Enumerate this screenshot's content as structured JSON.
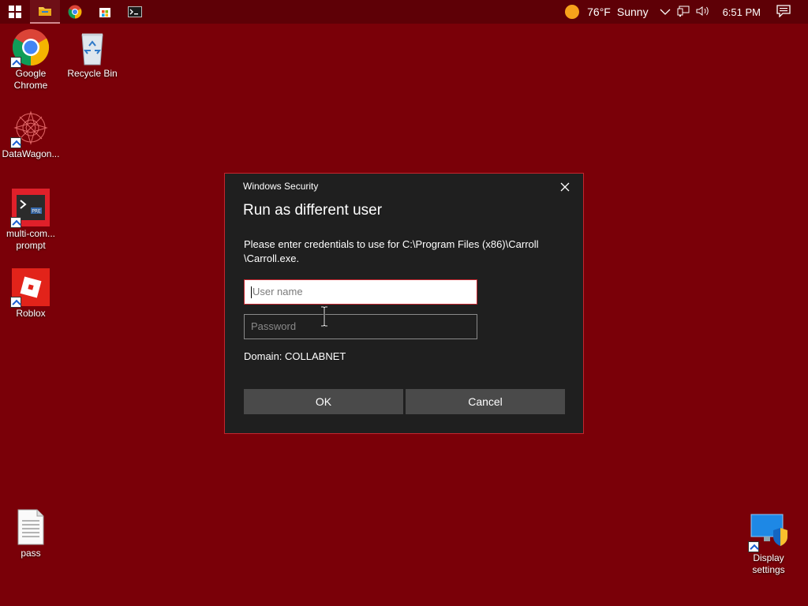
{
  "taskbar": {
    "pinned": [
      {
        "name": "start",
        "icon": "windows-logo-icon"
      },
      {
        "name": "file-explorer",
        "icon": "folder-icon"
      },
      {
        "name": "chrome",
        "icon": "chrome-icon"
      },
      {
        "name": "store",
        "icon": "store-icon"
      },
      {
        "name": "terminal",
        "icon": "terminal-icon"
      }
    ],
    "weather": {
      "temperature": "76°F",
      "condition": "Sunny"
    },
    "clock": "6:51 PM"
  },
  "desktop": {
    "icons": [
      {
        "label_line1": "Google",
        "label_line2": "Chrome",
        "icon": "chrome-icon"
      },
      {
        "label_line1": "Recycle Bin",
        "label_line2": "",
        "icon": "recycle-bin-icon"
      },
      {
        "label_line1": "DataWagon...",
        "label_line2": "",
        "icon": "datawagon-icon"
      },
      {
        "label_line1": "multi-com...",
        "label_line2": "prompt",
        "icon": "command-prompt-icon"
      },
      {
        "label_line1": "Roblox",
        "label_line2": "",
        "icon": "roblox-icon"
      },
      {
        "label_line1": "pass",
        "label_line2": "",
        "icon": "text-file-icon"
      },
      {
        "label_line1": "Display",
        "label_line2": "settings",
        "icon": "display-settings-icon"
      }
    ]
  },
  "dialog": {
    "caption": "Windows Security",
    "title": "Run as different user",
    "message_line1": "Please enter credentials to use for C:\\Program Files (x86)\\Carroll",
    "message_line2": "\\Carroll.exe.",
    "username": {
      "placeholder": "User name",
      "value": ""
    },
    "password": {
      "placeholder": "Password",
      "value": ""
    },
    "domain": "Domain: COLLABNET",
    "ok_label": "OK",
    "cancel_label": "Cancel"
  },
  "colors": {
    "desktop_background": "#7a0008",
    "taskbar": "#5e0006",
    "dialog_background": "#1f1f1f",
    "accent": "#c4262e"
  }
}
